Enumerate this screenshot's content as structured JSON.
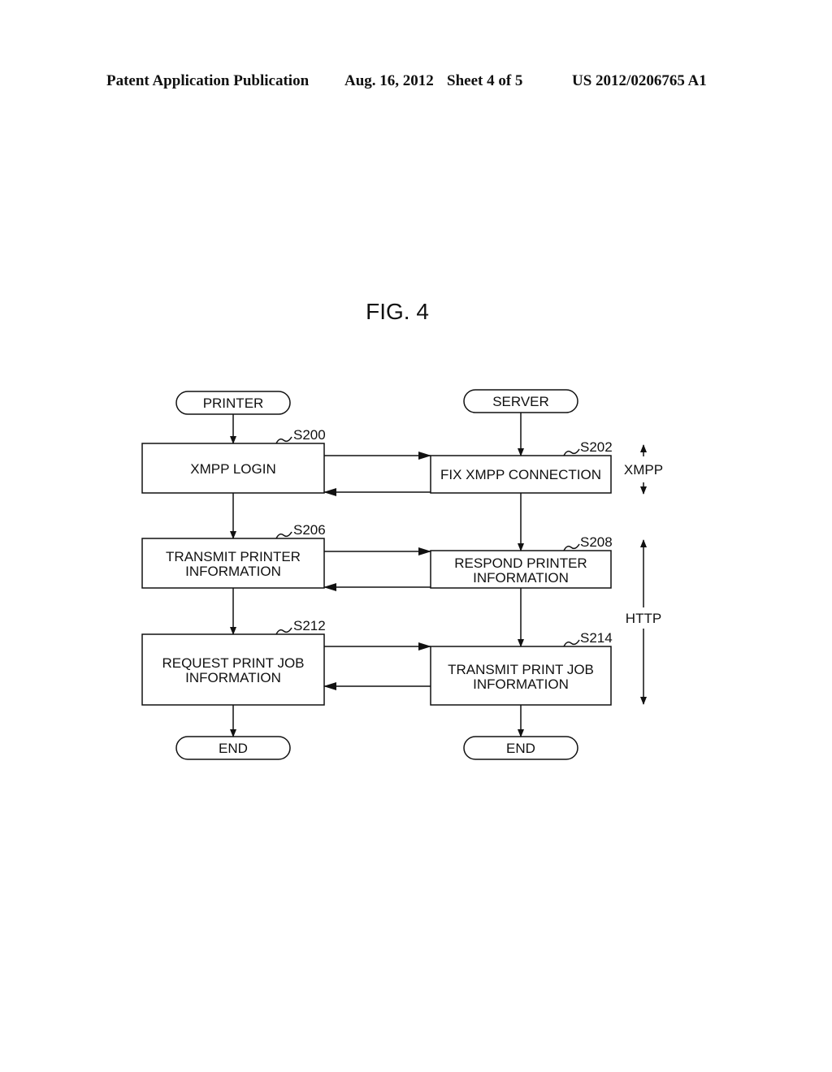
{
  "header": {
    "publication": "Patent Application Publication",
    "date": "Aug. 16, 2012",
    "sheet": "Sheet 4 of 5",
    "number": "US 2012/0206765 A1"
  },
  "figure": {
    "title": "FIG. 4",
    "terminals": {
      "printer_start": "PRINTER",
      "server_start": "SERVER",
      "printer_end": "END",
      "server_end": "END"
    },
    "printer_steps": [
      {
        "id": "S200",
        "lines": [
          "XMPP LOGIN"
        ]
      },
      {
        "id": "S206",
        "lines": [
          "TRANSMIT PRINTER",
          "INFORMATION"
        ]
      },
      {
        "id": "S212",
        "lines": [
          "REQUEST PRINT JOB",
          "INFORMATION"
        ]
      }
    ],
    "server_steps": [
      {
        "id": "S202",
        "lines": [
          "FIX XMPP CONNECTION"
        ]
      },
      {
        "id": "S208",
        "lines": [
          "RESPOND PRINTER",
          "INFORMATION"
        ]
      },
      {
        "id": "S214",
        "lines": [
          "TRANSMIT PRINT JOB",
          "INFORMATION"
        ]
      }
    ],
    "protocols": {
      "xmpp": "XMPP",
      "http": "HTTP"
    }
  }
}
